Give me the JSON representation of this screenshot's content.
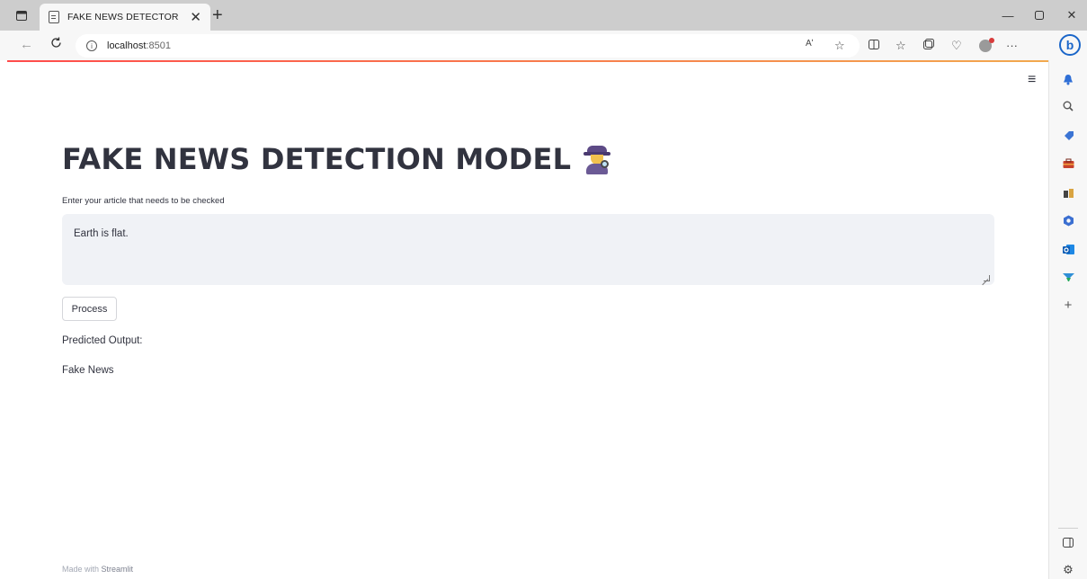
{
  "browser": {
    "tab_title": "FAKE NEWS DETECTOR",
    "url_host": "localhost",
    "url_port": ":8501",
    "read_aloud_label": "Aʹ"
  },
  "page": {
    "title": "FAKE NEWS DETECTION MODEL",
    "input_label": "Enter your article that needs to be checked",
    "input_value": "Earth is flat.",
    "process_button": "Process",
    "predicted_label": "Predicted Output:",
    "predicted_value": "Fake News",
    "footer_prefix": "Made with",
    "footer_brand": "Streamlit"
  },
  "colors": {
    "accent_line_start": "#ff4b4b",
    "accent_line_end": "#f2a94e",
    "textarea_bg": "#f0f2f6",
    "text": "#31333f",
    "bing_blue": "#1b66c9"
  },
  "icons": {
    "sidebar": [
      "bell-icon",
      "search-icon",
      "tag-icon",
      "toolbox-icon",
      "chess-icon",
      "office-icon",
      "outlook-icon",
      "filter-icon",
      "add-icon",
      "sidebar-panel-icon",
      "settings-icon"
    ]
  }
}
